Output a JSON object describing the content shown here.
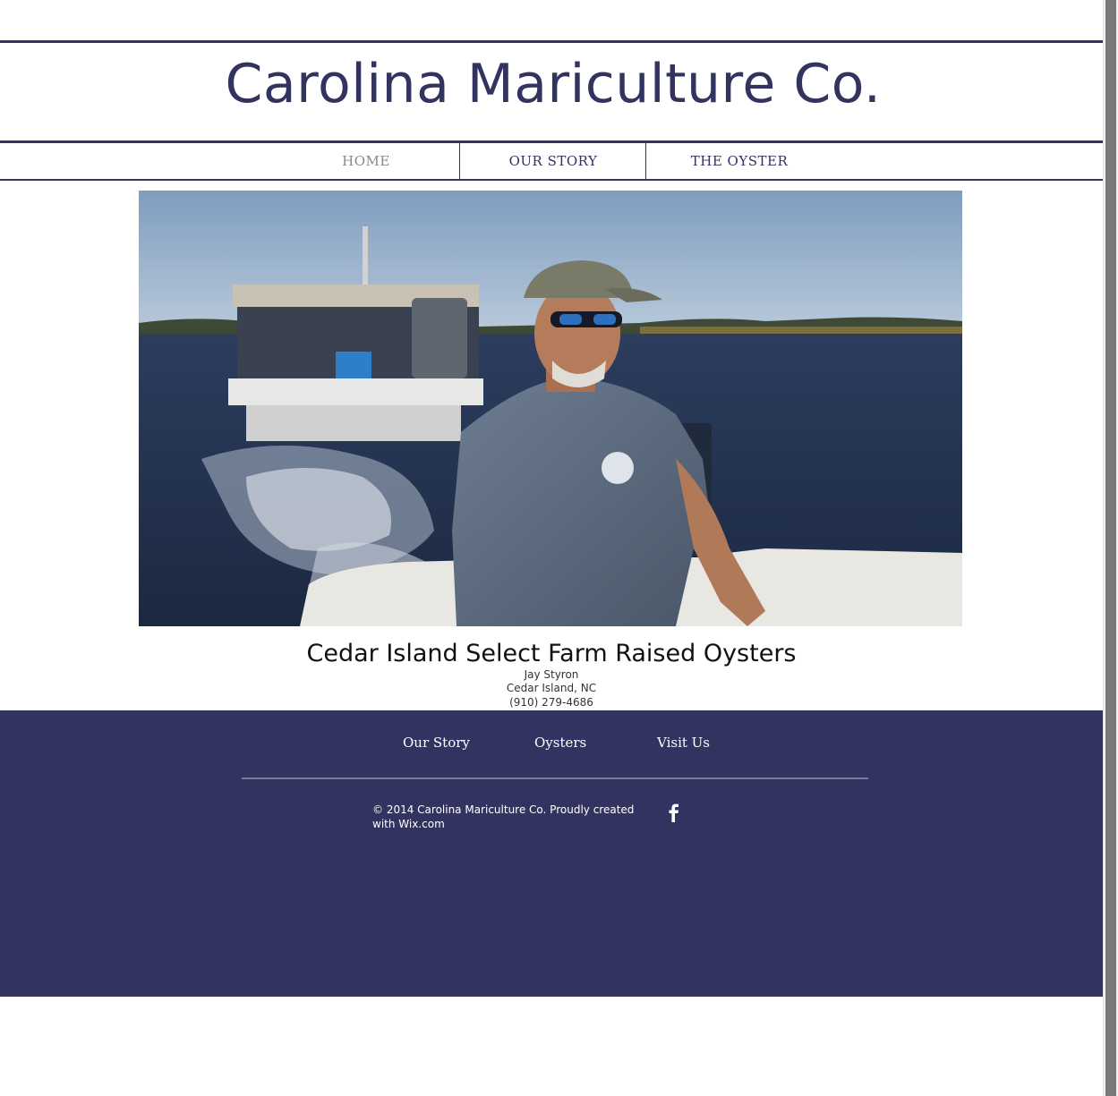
{
  "site": {
    "title": "Carolina Mariculture Co."
  },
  "nav": {
    "items": [
      {
        "label": "HOME",
        "active": true
      },
      {
        "label": "OUR STORY",
        "active": false
      },
      {
        "label": "THE OYSTER",
        "active": false
      }
    ]
  },
  "hero": {
    "image_subject": "man steering skiff towing oyster work barge"
  },
  "caption": {
    "title": "Cedar Island Select Farm Raised Oysters",
    "name": "Jay Styron",
    "location": "Cedar Island, NC",
    "phone": "(910) 279-4686"
  },
  "footer": {
    "links": [
      "Our Story",
      "Oysters",
      "Visit Us"
    ],
    "copyright": "© 2014 Carolina Mariculture Co. Proudly created with Wix.com",
    "social_icon": "facebook-icon"
  },
  "colors": {
    "brand": "#33335f",
    "footer_bg": "#333362",
    "nav_active": "#8a8a8a"
  }
}
